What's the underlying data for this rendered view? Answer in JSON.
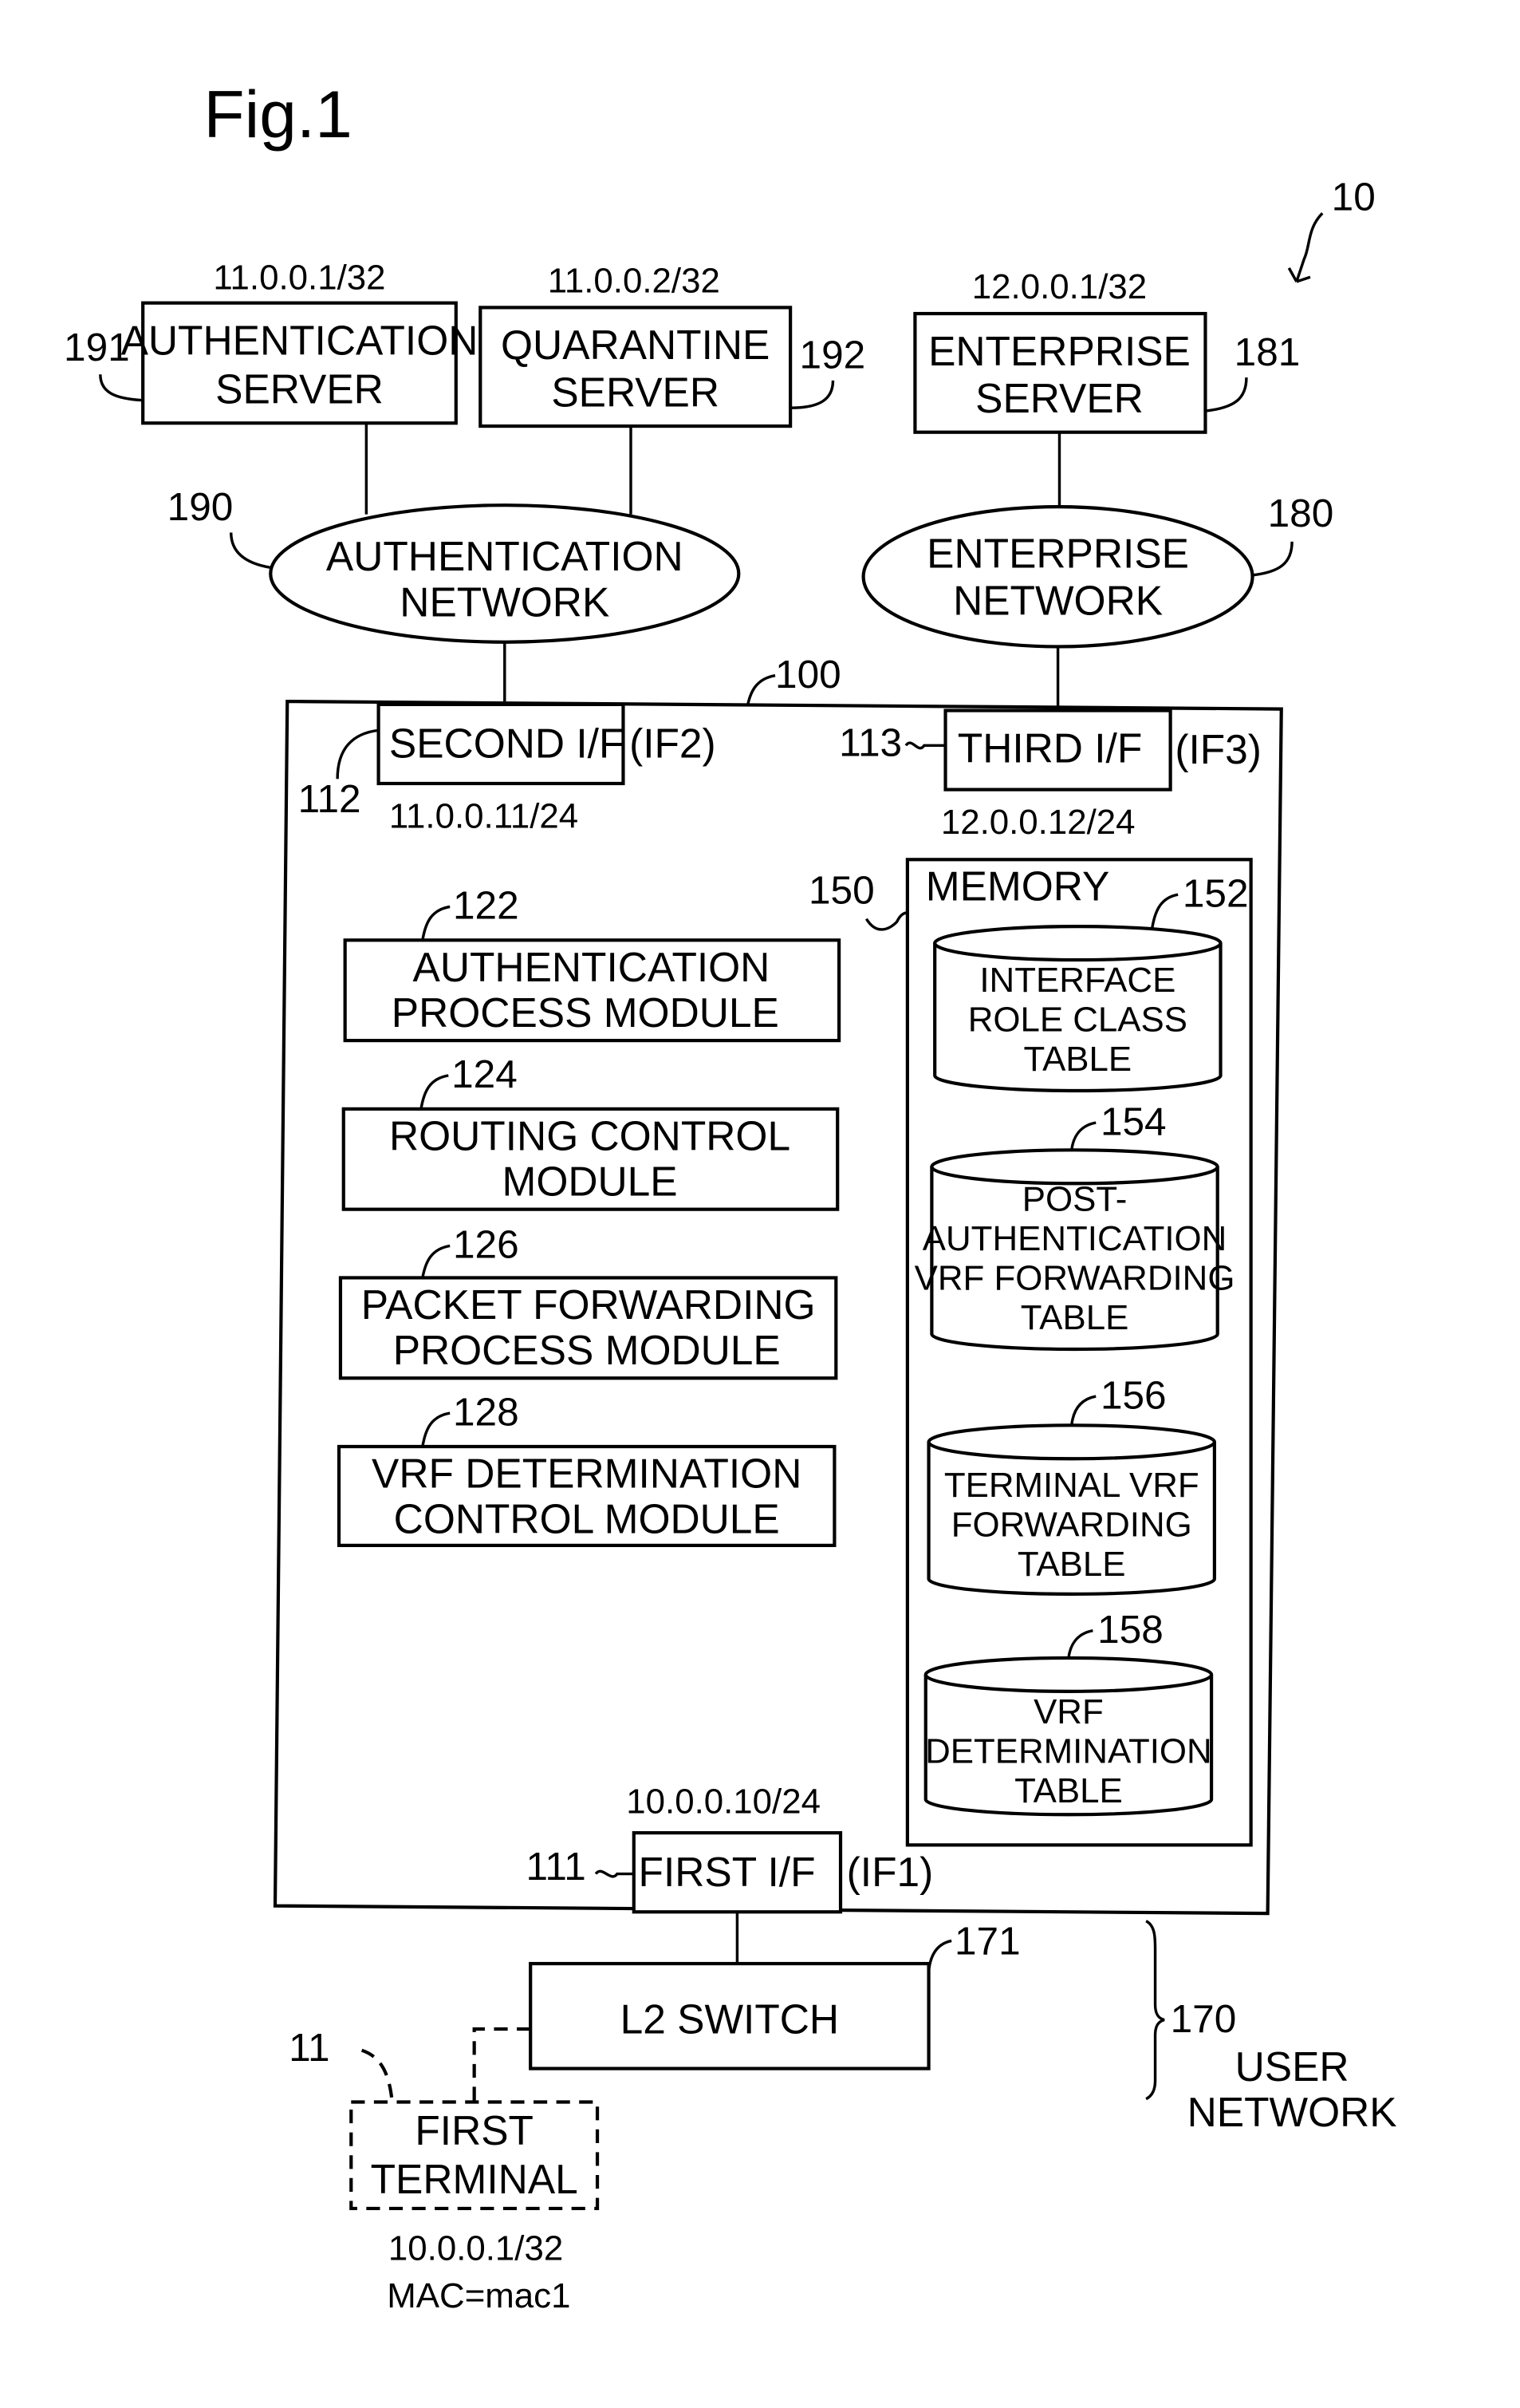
{
  "figure": {
    "title": "Fig.1",
    "system_ref": "10"
  },
  "servers": {
    "authentication": {
      "ip": "11.0.0.1/32",
      "ref": "191",
      "lines": [
        "AUTHENTICATION",
        "SERVER"
      ]
    },
    "quarantine": {
      "ip": "11.0.0.2/32",
      "ref": "192",
      "lines": [
        "QUARANTINE",
        "SERVER"
      ]
    },
    "enterprise": {
      "ip": "12.0.0.1/32",
      "ref": "181",
      "lines": [
        "ENTERPRISE",
        "SERVER"
      ]
    }
  },
  "networks": {
    "authentication": {
      "ref": "190",
      "lines": [
        "AUTHENTICATION",
        "NETWORK"
      ]
    },
    "enterprise": {
      "ref": "180",
      "lines": [
        "ENTERPRISE",
        "NETWORK"
      ]
    },
    "user": {
      "ref": "170",
      "lines": [
        "USER",
        "NETWORK"
      ]
    }
  },
  "device": {
    "ref": "100",
    "interfaces": {
      "second": {
        "label": "SECOND I/F",
        "tag": "(IF2)",
        "ref": "112",
        "ip": "11.0.0.11/24"
      },
      "third": {
        "label": "THIRD I/F",
        "tag": "(IF3)",
        "ref": "113",
        "ip": "12.0.0.12/24"
      },
      "first": {
        "label": "FIRST I/F",
        "tag": "(IF1)",
        "ref": "111",
        "ip": "10.0.0.10/24"
      }
    },
    "modules": [
      {
        "ref": "122",
        "lines": [
          "AUTHENTICATION",
          "PROCESS MODULE"
        ]
      },
      {
        "ref": "124",
        "lines": [
          "ROUTING CONTROL",
          "MODULE"
        ]
      },
      {
        "ref": "126",
        "lines": [
          "PACKET FORWARDING",
          "PROCESS MODULE"
        ]
      },
      {
        "ref": "128",
        "lines": [
          "VRF DETERMINATION",
          "CONTROL MODULE"
        ]
      }
    ],
    "memory": {
      "label": "MEMORY",
      "ref": "150",
      "tables": [
        {
          "ref": "152",
          "lines": [
            "INTERFACE",
            "ROLE CLASS",
            "TABLE"
          ]
        },
        {
          "ref": "154",
          "lines": [
            "POST-",
            "AUTHENTICATION",
            "VRF FORWARDING",
            "TABLE"
          ]
        },
        {
          "ref": "156",
          "lines": [
            "TERMINAL VRF",
            "FORWARDING",
            "TABLE"
          ]
        },
        {
          "ref": "158",
          "lines": [
            "VRF",
            "DETERMINATION",
            "TABLE"
          ]
        }
      ]
    }
  },
  "l2_switch": {
    "label": "L2 SWITCH",
    "ref": "171"
  },
  "terminal": {
    "ref": "11",
    "lines": [
      "FIRST",
      "TERMINAL"
    ],
    "ip": "10.0.0.1/32",
    "mac": "MAC=mac1"
  }
}
